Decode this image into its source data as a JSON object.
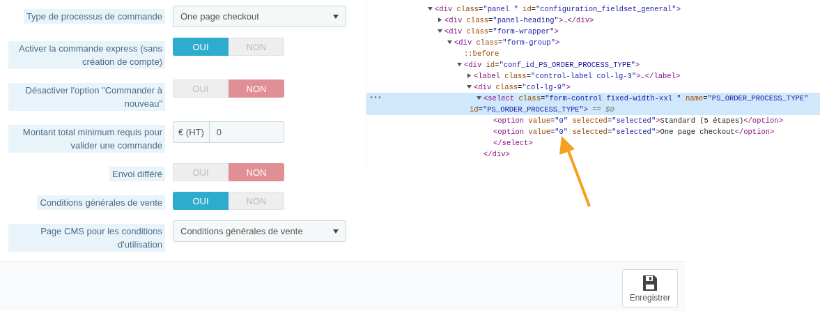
{
  "form": {
    "rows": [
      {
        "kind": "select",
        "label": "Type de processus de commande",
        "value": "One page checkout"
      },
      {
        "kind": "toggle",
        "label": "Activer la commande express (sans création de compte)",
        "options": [
          {
            "label": "OUI",
            "selected": true
          },
          {
            "label": "NON",
            "selected": false
          }
        ]
      },
      {
        "kind": "toggle",
        "label": "Désactiver l'option \"Commander à nouveau\"",
        "options": [
          {
            "label": "OUI",
            "selected": false
          },
          {
            "label": "NON",
            "selected": true
          }
        ]
      },
      {
        "kind": "input_group",
        "label": "Montant total minimum requis pour valider une commande",
        "addon": "€ (HT)",
        "value": "0"
      },
      {
        "kind": "toggle",
        "label": "Envoi différé",
        "options": [
          {
            "label": "OUI",
            "selected": false
          },
          {
            "label": "NON",
            "selected": true
          }
        ]
      },
      {
        "kind": "toggle",
        "label": "Conditions générales de vente",
        "options": [
          {
            "label": "OUI",
            "selected": true
          },
          {
            "label": "NON",
            "selected": false
          }
        ]
      },
      {
        "kind": "select",
        "label": "Page CMS pour les conditions d'utilisation",
        "value": "Conditions générales de vente"
      }
    ]
  },
  "footer": {
    "save_button": "Enregistrer"
  },
  "devtools": {
    "tree": [
      {
        "kind": "element",
        "markup": "<div class=\"panel \" id=\"configuration_fieldset_general\">",
        "expanded": true,
        "selected": false,
        "children": [
          {
            "kind": "element",
            "markup": "<div class=\"panel-heading\">…</div>",
            "expanded": false,
            "selected": false
          },
          {
            "kind": "element",
            "markup": "<div class=\"form-wrapper\">",
            "expanded": true,
            "selected": false,
            "children": [
              {
                "kind": "element",
                "markup": "<div class=\"form-group\">",
                "expanded": true,
                "selected": false,
                "children": [
                  {
                    "kind": "pseudo",
                    "markup": "::before",
                    "selected": false
                  },
                  {
                    "kind": "element",
                    "markup": "<div id=\"conf_id_PS_ORDER_PROCESS_TYPE\">",
                    "expanded": true,
                    "selected": false,
                    "children": [
                      {
                        "kind": "element",
                        "markup": "<label class=\"control-label col-lg-3\">…</label>",
                        "expanded": false,
                        "selected": false
                      },
                      {
                        "kind": "element",
                        "markup": "<div class=\"col-lg-9\">",
                        "expanded": true,
                        "selected": false,
                        "children": [
                          {
                            "kind": "element",
                            "markup": "<select class=\"form-control fixed-width-xxl \" name=\"PS_ORDER_PROCESS_TYPE\"",
                            "markup_continued": "id=\"PS_ORDER_PROCESS_TYPE\">",
                            "expanded": true,
                            "selected": true,
                            "actions": "•••",
                            "suffix": "== $0",
                            "children": [
                              {
                                "kind": "element",
                                "markup": "<option value=\"0\" selected=\"selected\">Standard (5 étapes)</option>",
                                "selected": false
                              },
                              {
                                "kind": "element",
                                "markup": "<option value=\"0\" selected=\"selected\">One page checkout</option>",
                                "selected": false
                              },
                              {
                                "kind": "element",
                                "markup": "</select>",
                                "selected": false
                              }
                            ]
                          },
                          {
                            "kind": "element",
                            "markup": "</div>",
                            "selected": false
                          }
                        ]
                      }
                    ]
                  }
                ]
              }
            ]
          }
        ]
      }
    ]
  }
}
